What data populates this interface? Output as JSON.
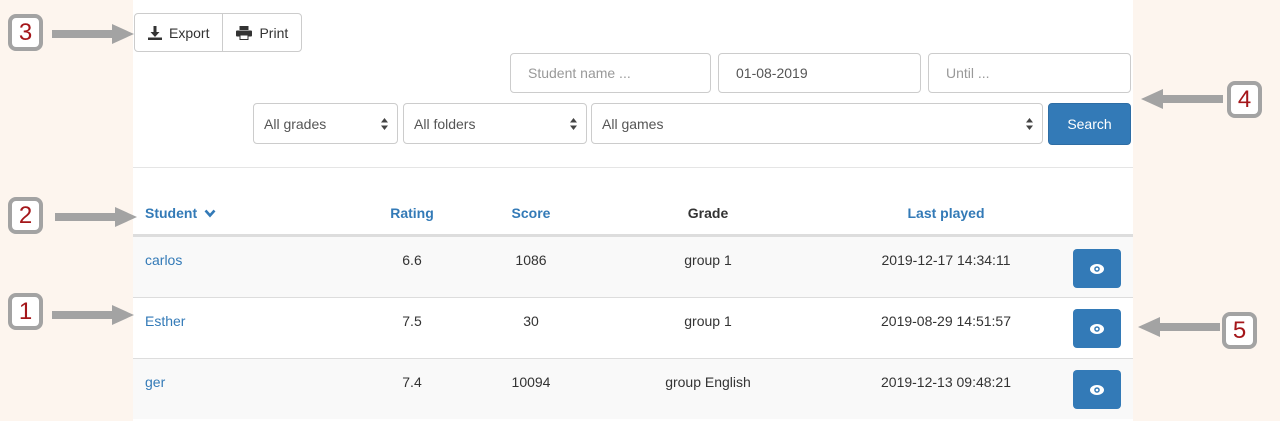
{
  "toolbar": {
    "export_label": "Export",
    "print_label": "Print"
  },
  "filters": {
    "student_placeholder": "Student name ...",
    "from_value": "01-08-2019",
    "until_placeholder": "Until ...",
    "grade_selected": "All grades",
    "folder_selected": "All folders",
    "game_selected": "All games",
    "search_label": "Search"
  },
  "table": {
    "headers": {
      "student": "Student",
      "rating": "Rating",
      "score": "Score",
      "grade": "Grade",
      "last_played": "Last played"
    },
    "rows": [
      {
        "student": "carlos",
        "rating": "6.6",
        "score": "1086",
        "grade": "group 1",
        "last_played": "2019-12-17 14:34:11"
      },
      {
        "student": "Esther",
        "rating": "7.5",
        "score": "30",
        "grade": "group 1",
        "last_played": "2019-08-29 14:51:57"
      },
      {
        "student": "ger",
        "rating": "7.4",
        "score": "10094",
        "grade": "group English",
        "last_played": "2019-12-13 09:48:21"
      }
    ]
  },
  "callouts": {
    "c1": "1",
    "c2": "2",
    "c3": "3",
    "c4": "4",
    "c5": "5"
  },
  "colors": {
    "accent": "#337ab7",
    "callout_number": "#a4161a",
    "callout_border": "#a3a3a3",
    "background": "#fdf5ee"
  },
  "icons": {
    "export": "download-icon",
    "print": "printer-icon",
    "sort": "chevron-down-icon",
    "view": "eye-icon"
  }
}
